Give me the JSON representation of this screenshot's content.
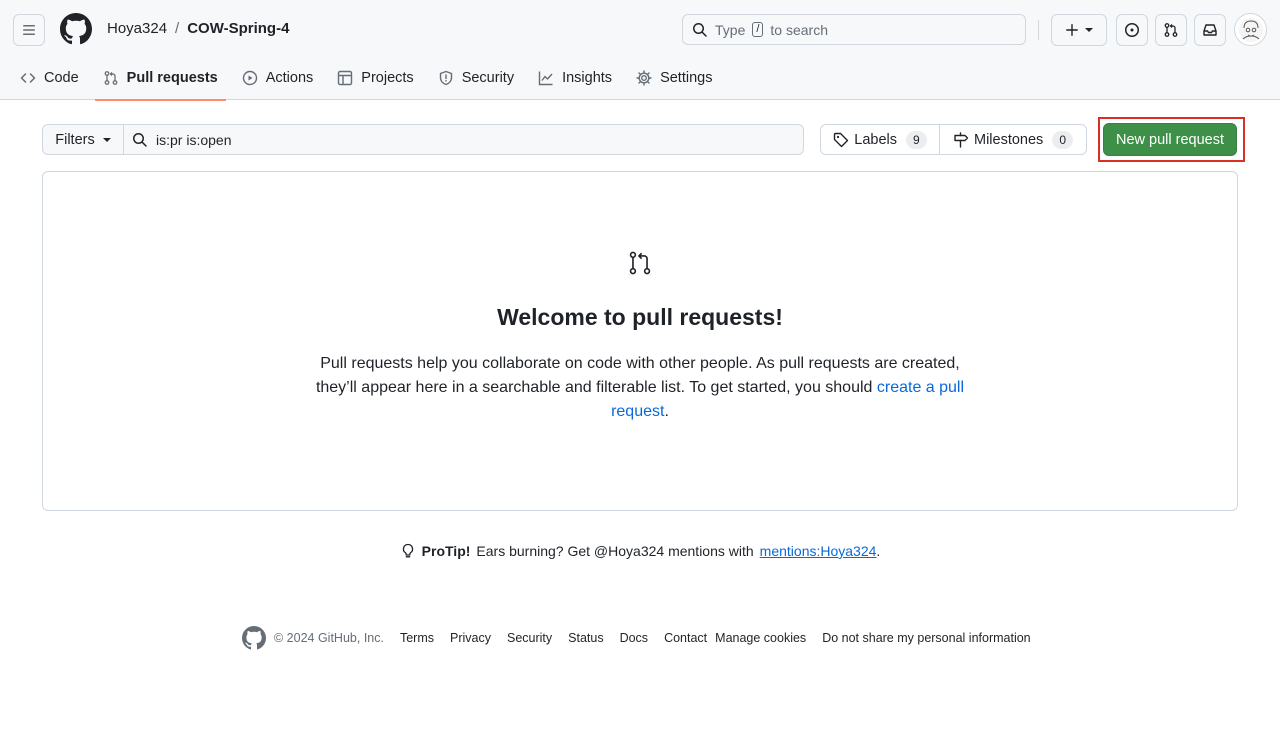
{
  "header": {
    "owner": "Hoya324",
    "separator": "/",
    "repo": "COW-Spring-4",
    "search": {
      "prefix": "Type",
      "key": "/",
      "suffix": "to search"
    }
  },
  "tabs": [
    {
      "label": "Code",
      "icon": "code-icon"
    },
    {
      "label": "Pull requests",
      "icon": "git-pull-request-icon"
    },
    {
      "label": "Actions",
      "icon": "play-icon"
    },
    {
      "label": "Projects",
      "icon": "table-icon"
    },
    {
      "label": "Security",
      "icon": "shield-icon"
    },
    {
      "label": "Insights",
      "icon": "graph-icon"
    },
    {
      "label": "Settings",
      "icon": "gear-icon"
    }
  ],
  "toolbar": {
    "filters_label": "Filters",
    "filter_query": "is:pr is:open",
    "labels_label": "Labels",
    "labels_count": "9",
    "milestones_label": "Milestones",
    "milestones_count": "0",
    "new_pr_label": "New pull request"
  },
  "blankslate": {
    "title": "Welcome to pull requests!",
    "text": "Pull requests help you collaborate on code with other people. As pull requests are created, they’ll appear here in a searchable and filterable list. To get started, you should ",
    "link": "create a pull request",
    "end": "."
  },
  "protip": {
    "label": "ProTip!",
    "text": "Ears burning? Get @Hoya324 mentions with",
    "link": "mentions:Hoya324",
    "end": "."
  },
  "footer": {
    "copyright": "© 2024 GitHub, Inc.",
    "links": [
      "Terms",
      "Privacy",
      "Security",
      "Status",
      "Docs",
      "Contact",
      "Manage cookies",
      "Do not share my personal information"
    ]
  },
  "colors": {
    "accent_underline": "#fd8c73",
    "primary_button": "#3e8f47",
    "highlight_box": "#d93025",
    "link": "#0969da"
  }
}
